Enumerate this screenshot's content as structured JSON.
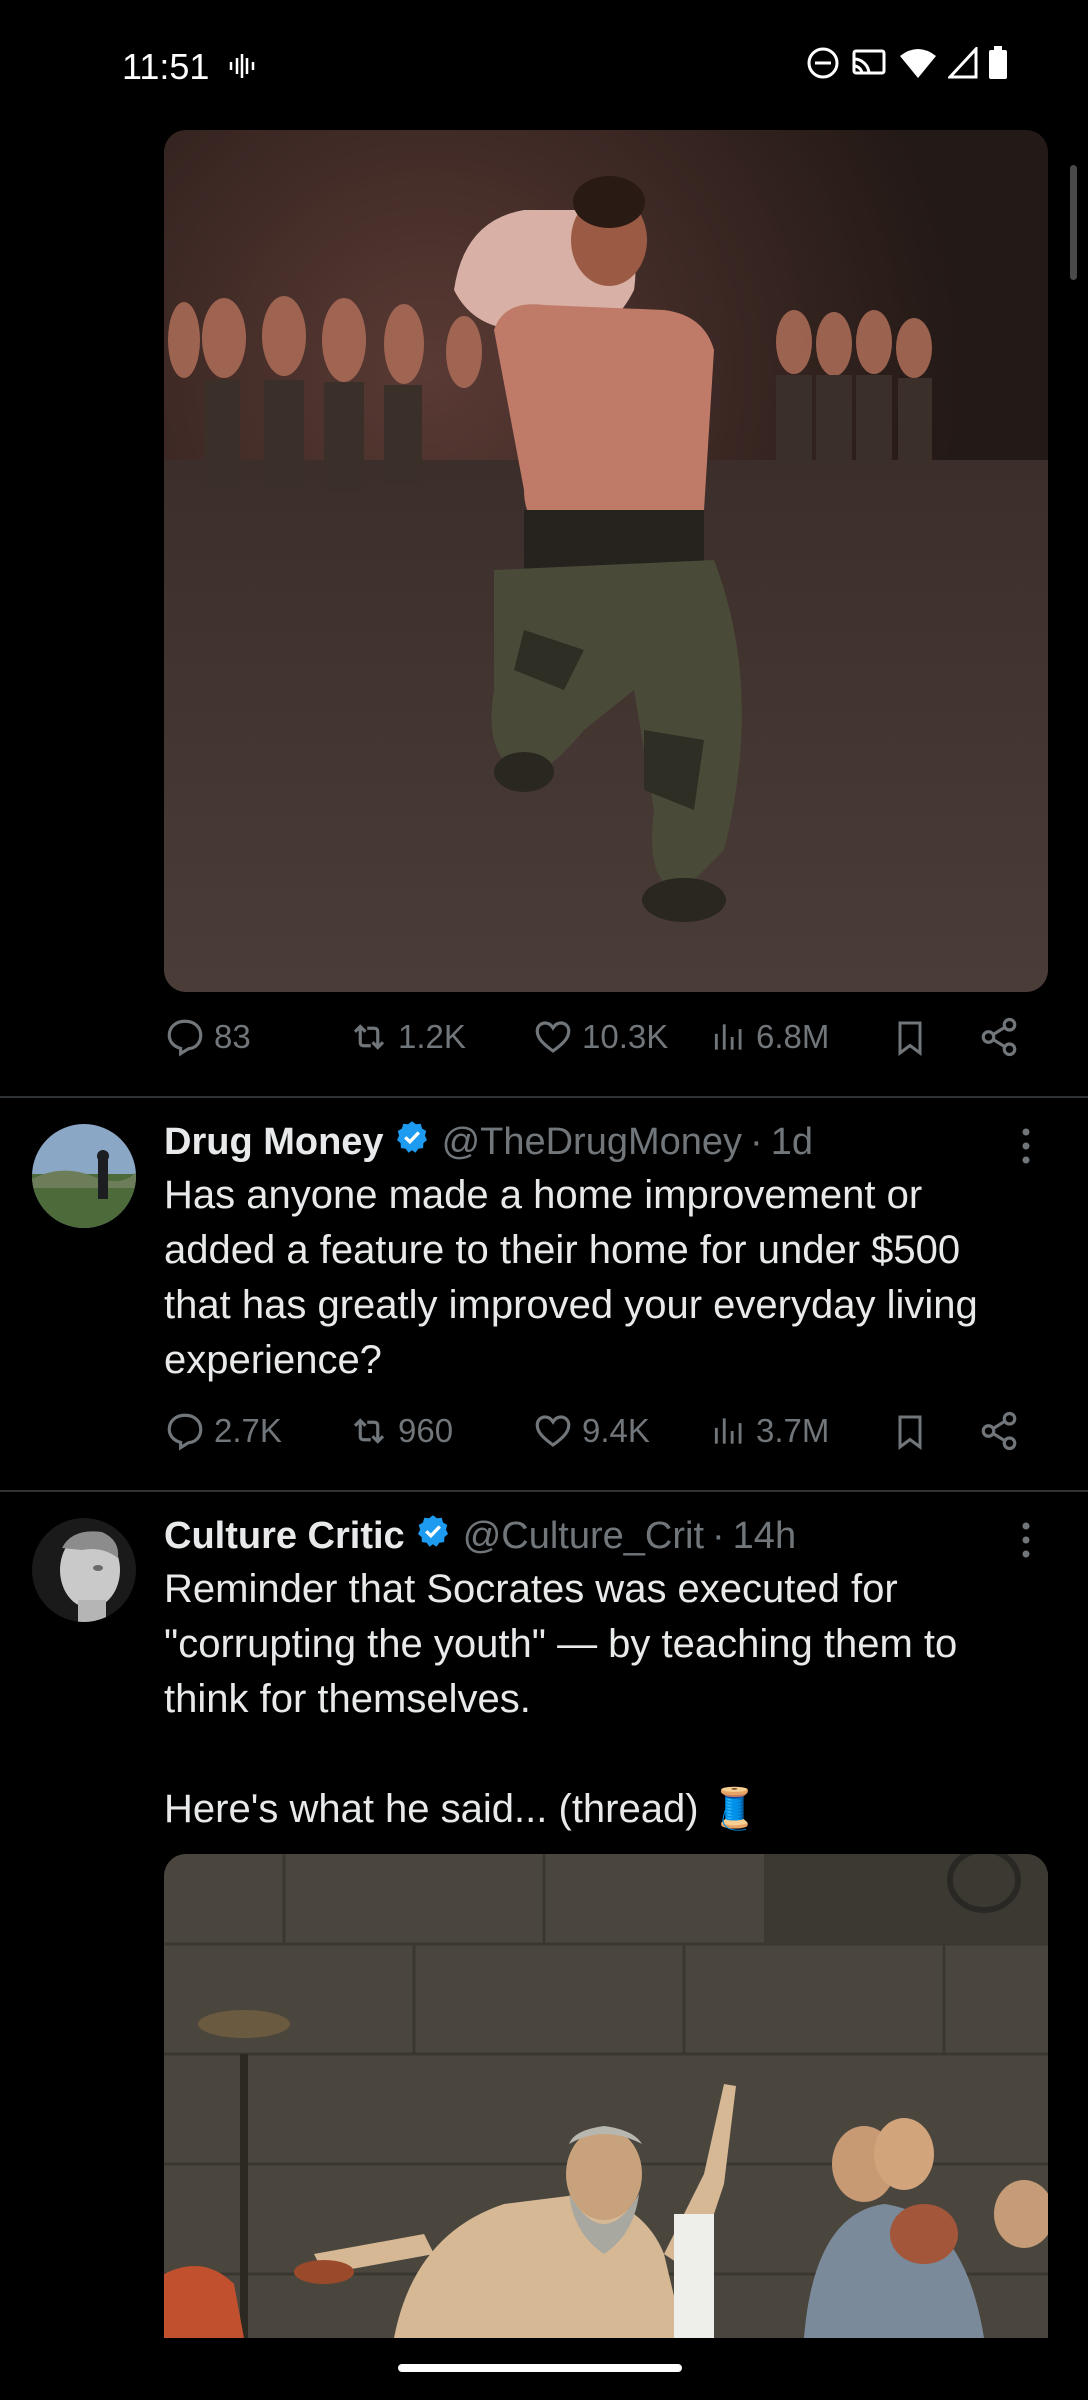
{
  "status_bar": {
    "time": "11:51"
  },
  "feed": [
    {
      "type": "media_tail",
      "media_alt": "shirtless soldier in camo pants kneeling on sand at night",
      "actions": {
        "replies": "83",
        "reposts": "1.2K",
        "likes": "10.3K",
        "views": "6.8M"
      }
    },
    {
      "type": "tweet",
      "display_name": "Drug Money",
      "handle": "@TheDrugMoney",
      "separator": "·",
      "time": "1d",
      "text_lines": [
        "Has anyone made a home improvement or",
        "added a feature to their home for under $500",
        "that has greatly improved your everyday living",
        "experience?"
      ],
      "actions": {
        "replies": "2.7K",
        "reposts": "960",
        "likes": "9.4K",
        "views": "3.7M"
      }
    },
    {
      "type": "tweet",
      "display_name": "Culture Critic",
      "handle": "@Culture_Crit",
      "separator": "·",
      "time": "14h",
      "text_lines": [
        "Reminder that Socrates was executed for",
        "\"corrupting the youth\" — by teaching them to",
        "think for themselves.",
        "",
        "Here's what he said... (thread) 🧵"
      ],
      "media_alt": "The Death of Socrates painting"
    }
  ],
  "colors": {
    "accent_verified": "#1d9bf0",
    "muted": "#71767b",
    "background": "#000000"
  },
  "icons": [
    "reply-icon",
    "repost-icon",
    "like-icon",
    "views-icon",
    "bookmark-icon",
    "share-icon",
    "more-icon",
    "verified-badge-icon"
  ]
}
